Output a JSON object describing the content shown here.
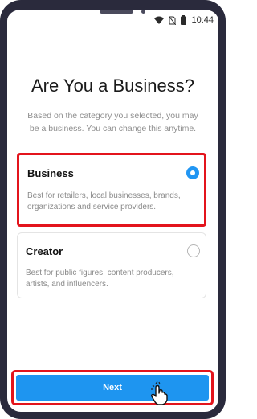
{
  "status_bar": {
    "time": "10:44",
    "icons": [
      "wifi-icon",
      "no-sim-icon",
      "battery-icon"
    ]
  },
  "screen": {
    "title": "Are You a Business?",
    "subtitle": "Based on the category you selected, you may be a business. You can change this anytime."
  },
  "options": [
    {
      "label": "Business",
      "description": "Best for retailers, local businesses, brands, organizations and service providers.",
      "selected": true
    },
    {
      "label": "Creator",
      "description": "Best for public figures, content producers, artists, and influencers.",
      "selected": false
    }
  ],
  "next_button": {
    "label": "Next"
  },
  "colors": {
    "accent": "#1e95f0",
    "highlight": "#e3141c",
    "radio_selected": "#2196f3"
  }
}
